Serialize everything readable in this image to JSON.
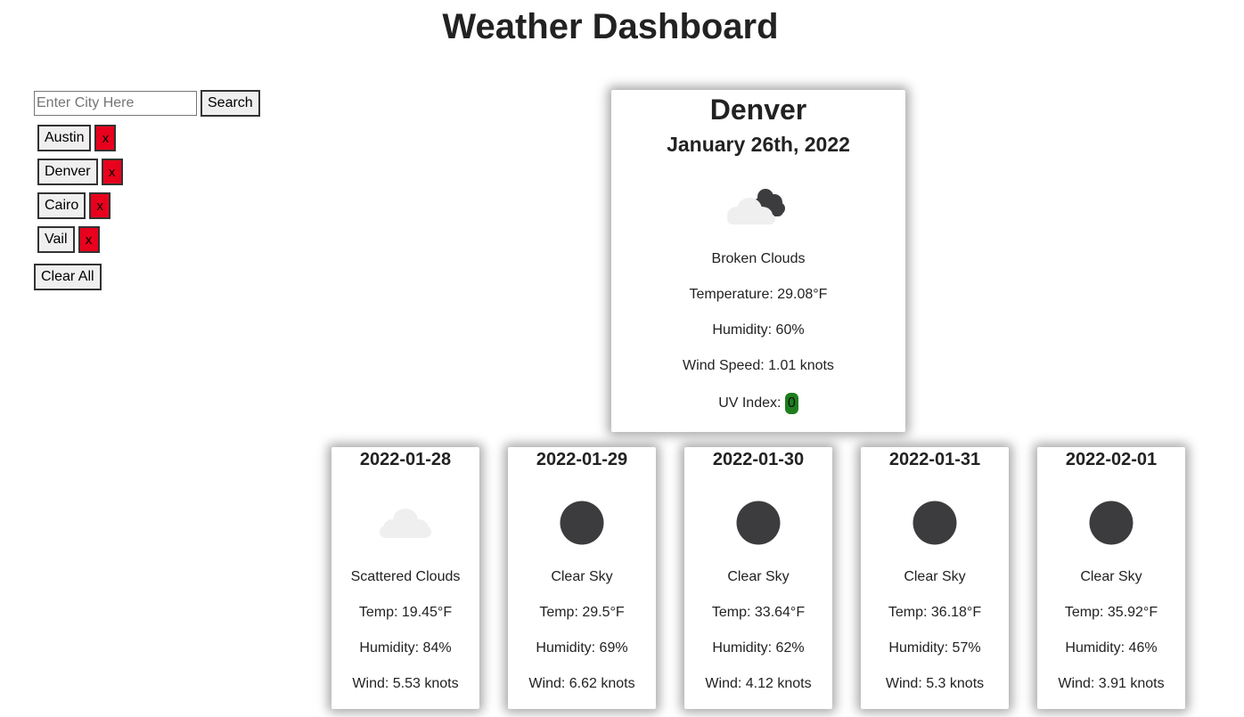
{
  "page": {
    "title": "Weather Dashboard"
  },
  "search": {
    "placeholder": "Enter City Here",
    "value": "",
    "button_label": "Search"
  },
  "history": {
    "cities": [
      {
        "label": "Austin",
        "delete_label": "x"
      },
      {
        "label": "Denver",
        "delete_label": "x"
      },
      {
        "label": "Cairo",
        "delete_label": "x"
      },
      {
        "label": "Vail",
        "delete_label": "x"
      }
    ],
    "clear_label": "Clear All"
  },
  "current": {
    "city": "Denver",
    "date": "January 26th, 2022",
    "icon": "broken-clouds-icon",
    "description": "Broken Clouds",
    "temperature": "Temperature: 29.08°F",
    "humidity": "Humidity: 60%",
    "wind": "Wind Speed: 1.01 knots",
    "uv_label": "UV Index:",
    "uv_value": "0",
    "uv_color": "#1e7d1e"
  },
  "forecast": [
    {
      "date": "2022-01-28",
      "icon": "scattered-clouds-icon",
      "description": "Scattered Clouds",
      "temp": "Temp: 19.45°F",
      "humidity": "Humidity: 84%",
      "wind": "Wind: 5.53 knots"
    },
    {
      "date": "2022-01-29",
      "icon": "clear-sky-night-icon",
      "description": "Clear Sky",
      "temp": "Temp: 29.5°F",
      "humidity": "Humidity: 69%",
      "wind": "Wind: 6.62 knots"
    },
    {
      "date": "2022-01-30",
      "icon": "clear-sky-night-icon",
      "description": "Clear Sky",
      "temp": "Temp: 33.64°F",
      "humidity": "Humidity: 62%",
      "wind": "Wind: 4.12 knots"
    },
    {
      "date": "2022-01-31",
      "icon": "clear-sky-night-icon",
      "description": "Clear Sky",
      "temp": "Temp: 36.18°F",
      "humidity": "Humidity: 57%",
      "wind": "Wind: 5.3 knots"
    },
    {
      "date": "2022-02-01",
      "icon": "clear-sky-night-icon",
      "description": "Clear Sky",
      "temp": "Temp: 35.92°F",
      "humidity": "Humidity: 46%",
      "wind": "Wind: 3.91 knots"
    }
  ]
}
